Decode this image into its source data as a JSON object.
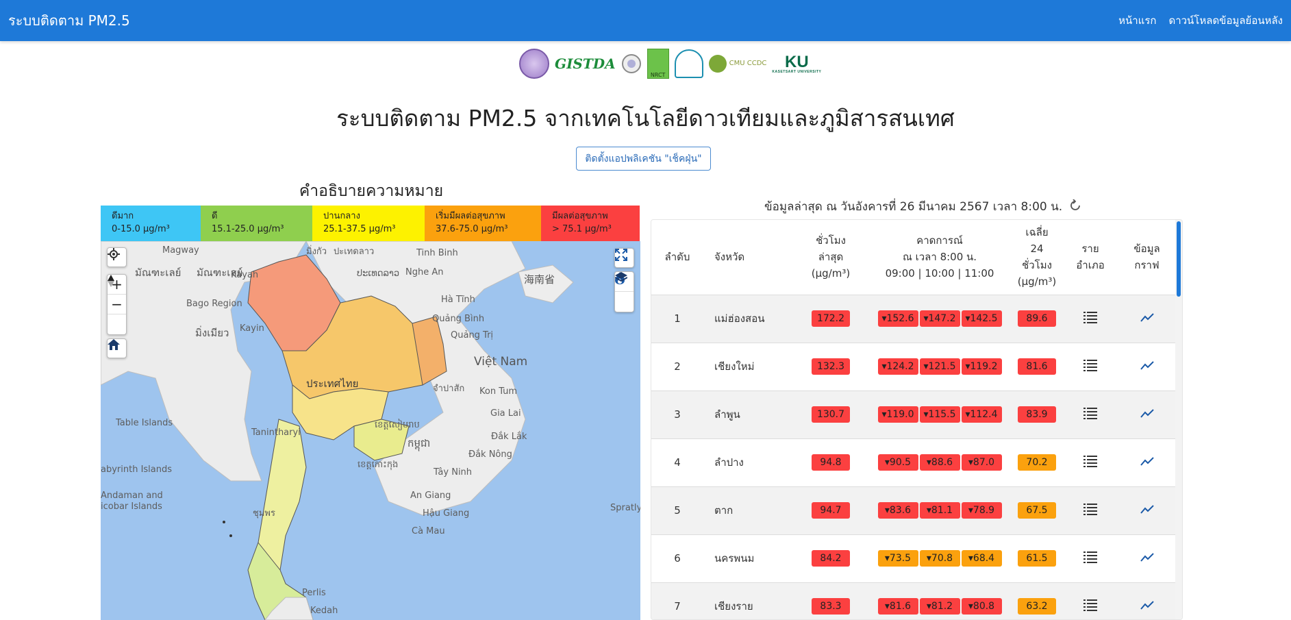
{
  "navbar": {
    "brand": "ระบบติดตาม PM2.5",
    "links": [
      "หน้าแรก",
      "ดาวน์โหลดข้อมูลย้อนหลัง"
    ]
  },
  "logos": {
    "gistda_text": "GISTDA",
    "nrct_text": "NRCT",
    "cmu_text": "CMU CCDC",
    "ku_text": "KU",
    "ku_sub": "KASETSART UNIVERSITY"
  },
  "page_title": "ระบบติดตาม PM2.5 จากเทคโนโลยีดาวเทียมและภูมิสารสนเทศ",
  "app_button": "ติดตั้งแอปพลิเคชัน \"เช็คฝุ่น\"",
  "legend_title": "คำอธิบายความหมาย",
  "legend": [
    {
      "label": "ดีมาก",
      "range": "0-15.0 µg/m³",
      "color": "#3ec6f5"
    },
    {
      "label": "ดี",
      "range": "15.1-25.0 µg/m³",
      "color": "#8fcf4e"
    },
    {
      "label": "ปานกลาง",
      "range": "25.1-37.5 µg/m³",
      "color": "#fdf200"
    },
    {
      "label": "เริ่มมีผลต่อสุขภาพ",
      "range": "37.6-75.0 µg/m³",
      "color": "#fba10e"
    },
    {
      "label": "มีผลต่อสุขภาพ",
      "range": "> 75.1 µg/m³",
      "color": "#fb4040"
    }
  ],
  "map": {
    "labels": [
      "Magway",
      "Kayah",
      "Bago Region",
      "มัณฑะเลย์",
      "มัณฑะเลย์",
      "มิ่งกัว",
      "ปะเทดลาว",
      "Tinh Binh",
      "Nghe An",
      "海南省",
      "Kayin",
      "มิ่งเมียว",
      "ປະເທດລາວ",
      "Hà Tĩnh",
      "Quảng Bình",
      "Quảng Trị",
      "Việt Nam",
      "ประเทศไทย",
      "จำปาสัก",
      "Kon Tum",
      "Gia Lai",
      "Đắk Lắk",
      "Đắk Nông",
      "Table Islands",
      "Tanintharyi",
      "ខេត្តសៀមរាប",
      "កម្ពុជា",
      "ខេត្តកោះកុង",
      "Tây Ninh",
      "abyrinth Islands",
      "Andaman and",
      "icobar Islands",
      "An Giang",
      "Hậu Giang",
      "Cà Mau",
      "Spratly I",
      "ชุมพร",
      "Perlis",
      "Kedah"
    ],
    "icons": [
      "locate-icon",
      "zoom-in-icon",
      "zoom-out-icon",
      "compass-icon",
      "home-icon",
      "fullscreen-icon",
      "fire-icon",
      "layers-icon"
    ]
  },
  "updated_text": "ข้อมูลล่าสุด ณ วันอังคารที่ 26 มีนาคม 2567 เวลา 8:00 น.",
  "table": {
    "headers": {
      "rank": "ลำดับ",
      "province": "จังหวัด",
      "latest_1": "ชั่วโมง",
      "latest_2": "ล่าสุด",
      "latest_3": "(µg/m³)",
      "forecast_1": "คาดการณ์",
      "forecast_2": "ณ เวลา 8:00 น.",
      "forecast_3": "09:00 | 10:00 | 11:00",
      "avg_1": "เฉลี่ย",
      "avg_2": "24",
      "avg_3": "ชั่วโมง",
      "avg_4": "(µg/m³)",
      "district_1": "ราย",
      "district_2": "อำเภอ",
      "graph_1": "ข้อมูล",
      "graph_2": "กราฟ"
    },
    "colors": {
      "red": "#fb4040",
      "orange": "#fba10e"
    },
    "rows": [
      {
        "rank": "1",
        "province": "แม่ฮ่องสอน",
        "latest": "172.2",
        "latest_color": "red",
        "f1": "▾152.6",
        "f2": "▾147.2",
        "f3": "▾142.5",
        "f_color": "red",
        "avg": "89.6",
        "avg_color": "red"
      },
      {
        "rank": "2",
        "province": "เชียงใหม่",
        "latest": "132.3",
        "latest_color": "red",
        "f1": "▾124.2",
        "f2": "▾121.5",
        "f3": "▾119.2",
        "f_color": "red",
        "avg": "81.6",
        "avg_color": "red"
      },
      {
        "rank": "3",
        "province": "ลำพูน",
        "latest": "130.7",
        "latest_color": "red",
        "f1": "▾119.0",
        "f2": "▾115.5",
        "f3": "▾112.4",
        "f_color": "red",
        "avg": "83.9",
        "avg_color": "red"
      },
      {
        "rank": "4",
        "province": "ลำปาง",
        "latest": "94.8",
        "latest_color": "red",
        "f1": "▾90.5",
        "f2": "▾88.6",
        "f3": "▾87.0",
        "f_color": "red",
        "avg": "70.2",
        "avg_color": "orange"
      },
      {
        "rank": "5",
        "province": "ตาก",
        "latest": "94.7",
        "latest_color": "red",
        "f1": "▾83.6",
        "f2": "▾81.1",
        "f3": "▾78.9",
        "f_color": "red",
        "avg": "67.5",
        "avg_color": "orange"
      },
      {
        "rank": "6",
        "province": "นครพนม",
        "latest": "84.2",
        "latest_color": "red",
        "f1": "▾73.5",
        "f2": "▾70.8",
        "f3": "▾68.4",
        "f_color": "orange",
        "avg": "61.5",
        "avg_color": "orange"
      },
      {
        "rank": "7",
        "province": "เชียงราย",
        "latest": "83.3",
        "latest_color": "red",
        "f1": "▾81.6",
        "f2": "▾81.2",
        "f3": "▾80.8",
        "f_color": "red",
        "avg": "63.2",
        "avg_color": "orange"
      }
    ]
  }
}
